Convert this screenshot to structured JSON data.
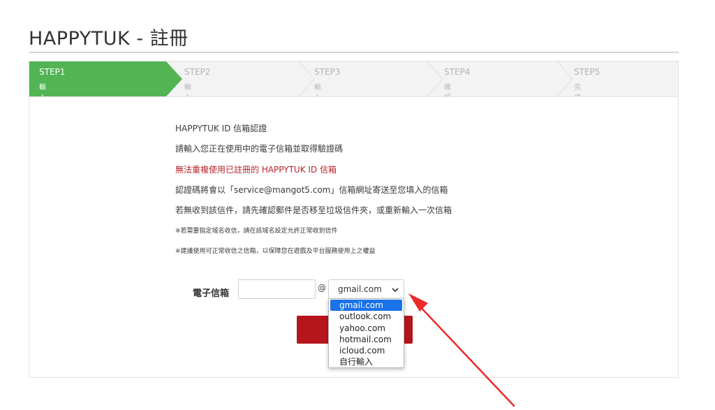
{
  "page": {
    "title": "HAPPYTUK - 註冊"
  },
  "steps": [
    {
      "label": "STEP1",
      "sub": "輸入信箱",
      "active": true
    },
    {
      "label": "STEP2",
      "sub": "輸入認證碼",
      "active": false
    },
    {
      "label": "STEP3",
      "sub": "輸入資料",
      "active": false
    },
    {
      "label": "STEP4",
      "sub": "確認資料",
      "active": false
    },
    {
      "label": "STEP5",
      "sub": "完成註冊",
      "active": false
    }
  ],
  "info": {
    "heading": "HAPPYTUK ID 信箱認證",
    "line1": "請輸入您正在使用中的電子信箱並取得驗證碼",
    "warning": "無法重複使用已註冊的 HAPPYTUK ID 信箱",
    "line2": "認證碼將會以「service@mangot5.com」信箱網址寄送至您填入的信箱",
    "line3": "若無收到該信件，請先確認郵件是否移至垃圾信件夾，或重新輸入一次信箱",
    "note1": "※若需要指定域名收信，請在該域名設定允許正常收到信件",
    "note2": "※建議使用可正常收信之信箱，以保障您在遊戲及平台服務使用上之權益"
  },
  "form": {
    "email_label": "電子信箱",
    "email_value": "",
    "at_sign": "@",
    "domain_selected": "gmail.com",
    "domain_options": [
      "gmail.com",
      "outlook.com",
      "yahoo.com",
      "hotmail.com",
      "icloud.com",
      "自行輸入"
    ]
  },
  "colors": {
    "active_step": "#52b453",
    "warning_text": "#b7232a",
    "submit_button": "#b5161c",
    "option_highlight": "#1a73e8",
    "annotation_arrow": "#ec2a2a"
  }
}
